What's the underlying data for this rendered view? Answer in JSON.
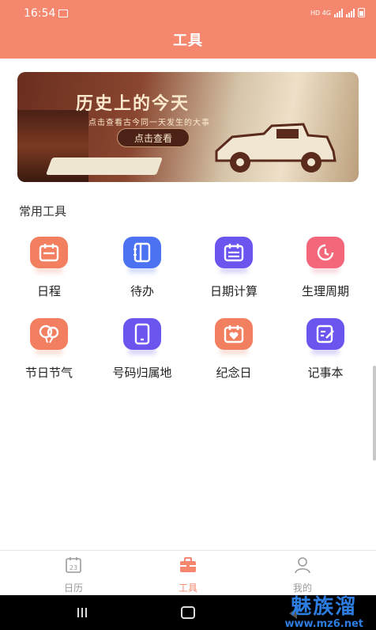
{
  "status_bar": {
    "time": "16:54",
    "network_label": "HD 4G"
  },
  "header": {
    "title": "工具"
  },
  "banner": {
    "title": "历史上的今天",
    "subtitle": "点击查看古今同一天发生的大事",
    "button_label": "点击查看"
  },
  "section": {
    "title": "常用工具"
  },
  "tools": [
    {
      "label": "日程",
      "icon": "calendar-icon",
      "color": "#f28060"
    },
    {
      "label": "待办",
      "icon": "notebook-icon",
      "color": "#4c72f2"
    },
    {
      "label": "日期计算",
      "icon": "calendar-icon",
      "color": "#6a55ee"
    },
    {
      "label": "生理周期",
      "icon": "clock-icon",
      "color": "#f4677a"
    },
    {
      "label": "节日节气",
      "icon": "balloons-icon",
      "color": "#f28060"
    },
    {
      "label": "号码归属地",
      "icon": "phone-icon",
      "color": "#6a55ee"
    },
    {
      "label": "纪念日",
      "icon": "heart-calendar-icon",
      "color": "#f28060"
    },
    {
      "label": "记事本",
      "icon": "edit-note-icon",
      "color": "#6a55ee"
    }
  ],
  "tabs": [
    {
      "label": "日历",
      "icon": "calendar-icon",
      "badge": "23",
      "active": false
    },
    {
      "label": "工具",
      "icon": "toolbox-icon",
      "active": true
    },
    {
      "label": "我的",
      "icon": "user-icon",
      "active": false
    }
  ],
  "watermark": {
    "line1": "魅族溜",
    "line2": "www.mz6.net"
  },
  "colors": {
    "accent": "#f4876e",
    "tab_inactive": "#9a9a9a"
  }
}
